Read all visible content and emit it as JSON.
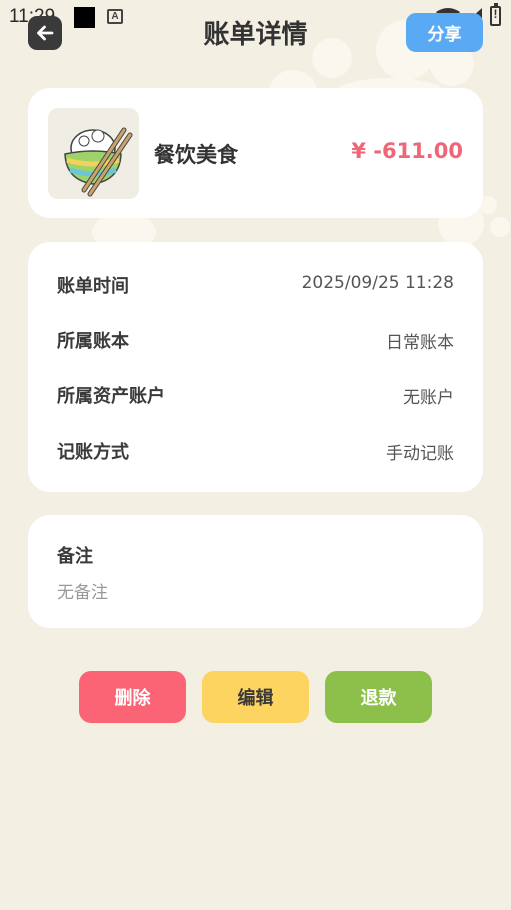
{
  "status_bar": {
    "time": "11:29",
    "a_icon": "A"
  },
  "header": {
    "title": "账单详情",
    "share_label": "分享"
  },
  "category": {
    "name": "餐饮美食",
    "amount": "¥ -611.00",
    "icon": "rice-bowl-icon"
  },
  "details": [
    {
      "label": "账单时间",
      "value": "2025/09/25 11:28"
    },
    {
      "label": "所属账本",
      "value": "日常账本"
    },
    {
      "label": "所属资产账户",
      "value": "无账户"
    },
    {
      "label": "记账方式",
      "value": "手动记账"
    }
  ],
  "note": {
    "label": "备注",
    "value": "无备注"
  },
  "actions": {
    "delete_label": "删除",
    "edit_label": "编辑",
    "refund_label": "退款"
  },
  "colors": {
    "background": "#f3efe2",
    "share": "#5aa9f5",
    "amount": "#ee6677",
    "delete": "#fb6474",
    "edit": "#fdd460",
    "refund": "#8cc04a"
  }
}
